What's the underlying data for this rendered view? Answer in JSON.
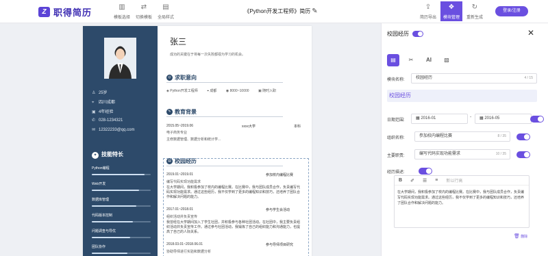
{
  "app": {
    "logo_text": "职得简历",
    "logo_mark": "Z"
  },
  "toolbar": {
    "template": "模板选择",
    "switch_template": "切换模板",
    "global_style": "全局样式",
    "doc_title": "《Python开发工程师》简历",
    "smart_export": "简历导出",
    "module_manage": "模块管理",
    "regenerate": "重新生成",
    "login": "登录/注册"
  },
  "resume": {
    "name": "张三",
    "motto": "成功的关键在于将每一次失败都视为学习的机会。",
    "info": [
      "25岁",
      "四川成都",
      "4年经验",
      "028-1234321",
      "12322233@qq.com"
    ],
    "skills_title": "技能特长",
    "skills": [
      {
        "label": "Python编程",
        "level": 0.9
      },
      {
        "label": "Web开发",
        "level": 0.8
      },
      {
        "label": "数据库管理",
        "level": 0.75
      },
      {
        "label": "代码版本控制",
        "level": 0.7
      },
      {
        "label": "问题调查与导优",
        "level": 0.65
      },
      {
        "label": "团队协作",
        "level": 0.6
      }
    ],
    "sections": {
      "intent": "求职意向",
      "education": "教育背景",
      "campus": "校园经历"
    },
    "job_intent": {
      "position": "Python开发工程师",
      "city": "成都",
      "salary": "8000~10000",
      "status": "随时入职"
    },
    "education": {
      "period": "2015.05~2019.06",
      "school": "xxxx大学",
      "degree": "本科",
      "major": "电子商务专业",
      "desc": "主修数据管理、数据分析和统计学..."
    },
    "campus": [
      {
        "period": "2019.01~2019.01",
        "org": "参加校内编程比赛",
        "role": "编写代码实现功能需求",
        "desc": "在大学期间，我积极参加了校内的编程比赛。在比赛中，我与团队成员合作，负责编写代码实现功能需求。通过这些经历，我不仅学到了更多的编程知识和技巧，还培养了团队合作和解决问题的能力。"
      },
      {
        "period": "2017.01~2018.01",
        "org": "参与学生会活动",
        "role": "组织活动并负责宣传",
        "desc": "我曾经在大学期间加入了学生社团，并积极参与各种社团活动。在社团中，我主要负责组织活动并负责宣传工作。通过参与社团活动，我锻炼了自己的组织能力和沟通能力，也提高了自己的人际关系。"
      },
      {
        "period": "2018.03.01~2018.06.01",
        "org": "参与导师项目研究",
        "role": "协助导师进行实验和数据分析",
        "desc": ""
      }
    ]
  },
  "panel": {
    "title": "校园经历",
    "module_name_label": "模块名称:",
    "module_name_value": "校园经历",
    "module_count": "4 / 15",
    "section_header": "校园经历",
    "date_label": "日期范围:",
    "date_start": "2016-01",
    "date_end": "2016-05",
    "org_label": "组织名称:",
    "org_value": "参加校内编程比赛",
    "org_count": "8 / 35",
    "role_label": "主要职责:",
    "role_value": "编写代码实现功能需求",
    "role_count": "10 / 35",
    "desc_label": "经历描述:",
    "editor_placeholder": "新以行高",
    "editor_text": "在大学期间，我积极参加了校内的编程比赛。在比赛中，我与团队成员合作，负责编写代码实现功能需求。通过这些经历，我不仅学到了更多的编程知识和技巧，还培养了团队合作和解决问题的能力。",
    "delete": "删除",
    "accent": "#6a4fe0"
  }
}
